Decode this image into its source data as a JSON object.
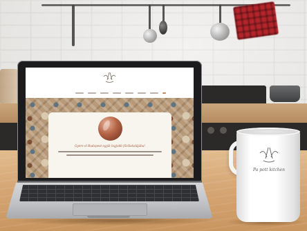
{
  "scene": {
    "description_none": "",
    "colors": {
      "wall": "#ecebe8",
      "table": "#d6a776",
      "laptop_lid": "#1c1c1e",
      "laptop_base": "#c0c1c4",
      "mug": "#ffffff",
      "towel": "#b4252b",
      "website_accent": "#a4553a"
    }
  },
  "laptop_screen": {
    "logo_icon": "whisk-crossed-utensils-icon",
    "site_name": "",
    "nav_items": 8,
    "hero_image": "terracotta-bowl-circle",
    "headline": "Gyere el Budapest egyik legjobb főzőiskolájába!"
  },
  "mug": {
    "logo_icon": "whisk-crossed-utensils-icon",
    "brand_text": "Pa pott kitchen"
  }
}
